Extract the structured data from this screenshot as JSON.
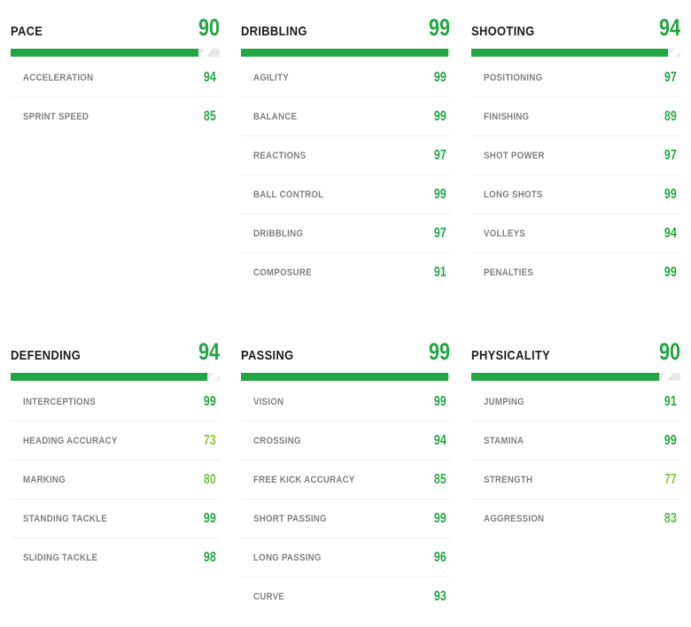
{
  "theme": {
    "background": "#ffffff",
    "title_color": "#1b1b1b",
    "label_color": "#808080",
    "divider_color": "#f0f0f0",
    "bar_track_color": "#e9e9e9",
    "bar_fill_color": "#22a544",
    "value_color_high": "#22a544",
    "value_color_mid": "#4cb050",
    "value_color_low": "#8cc63f"
  },
  "groups": [
    {
      "name": "PACE",
      "value": "90",
      "value_color": "#22a544",
      "bar_percent": 90,
      "stats": [
        {
          "label": "ACCELERATION",
          "value": "94",
          "color": "#22a544"
        },
        {
          "label": "SPRINT SPEED",
          "value": "85",
          "color": "#2faa48"
        }
      ]
    },
    {
      "name": "DRIBBLING",
      "value": "99",
      "value_color": "#22a544",
      "bar_percent": 99,
      "stats": [
        {
          "label": "AGILITY",
          "value": "99",
          "color": "#22a544"
        },
        {
          "label": "BALANCE",
          "value": "99",
          "color": "#22a544"
        },
        {
          "label": "REACTIONS",
          "value": "97",
          "color": "#22a544"
        },
        {
          "label": "BALL CONTROL",
          "value": "99",
          "color": "#22a544"
        },
        {
          "label": "DRIBBLING",
          "value": "97",
          "color": "#22a544"
        },
        {
          "label": "COMPOSURE",
          "value": "91",
          "color": "#2aa847"
        }
      ]
    },
    {
      "name": "SHOOTING",
      "value": "94",
      "value_color": "#22a544",
      "bar_percent": 94,
      "stats": [
        {
          "label": "POSITIONING",
          "value": "97",
          "color": "#22a544"
        },
        {
          "label": "FINISHING",
          "value": "89",
          "color": "#35ac4b"
        },
        {
          "label": "SHOT POWER",
          "value": "97",
          "color": "#22a544"
        },
        {
          "label": "LONG SHOTS",
          "value": "99",
          "color": "#22a544"
        },
        {
          "label": "VOLLEYS",
          "value": "94",
          "color": "#22a544"
        },
        {
          "label": "PENALTIES",
          "value": "99",
          "color": "#22a544"
        }
      ]
    },
    {
      "name": "DEFENDING",
      "value": "94",
      "value_color": "#22a544",
      "bar_percent": 94,
      "stats": [
        {
          "label": "INTERCEPTIONS",
          "value": "99",
          "color": "#22a544"
        },
        {
          "label": "HEADING ACCURACY",
          "value": "73",
          "color": "#8cc63f"
        },
        {
          "label": "MARKING",
          "value": "80",
          "color": "#7cbf43"
        },
        {
          "label": "STANDING TACKLE",
          "value": "99",
          "color": "#22a544"
        },
        {
          "label": "SLIDING TACKLE",
          "value": "98",
          "color": "#22a544"
        }
      ]
    },
    {
      "name": "PASSING",
      "value": "99",
      "value_color": "#22a544",
      "bar_percent": 99,
      "stats": [
        {
          "label": "VISION",
          "value": "99",
          "color": "#22a544"
        },
        {
          "label": "CROSSING",
          "value": "94",
          "color": "#22a544"
        },
        {
          "label": "FREE KICK ACCURACY",
          "value": "85",
          "color": "#2faa48"
        },
        {
          "label": "SHORT PASSING",
          "value": "99",
          "color": "#22a544"
        },
        {
          "label": "LONG PASSING",
          "value": "96",
          "color": "#22a544"
        },
        {
          "label": "CURVE",
          "value": "93",
          "color": "#22a544"
        }
      ]
    },
    {
      "name": "PHYSICALITY",
      "value": "90",
      "value_color": "#22a544",
      "bar_percent": 90,
      "stats": [
        {
          "label": "JUMPING",
          "value": "91",
          "color": "#2aa847"
        },
        {
          "label": "STAMINA",
          "value": "99",
          "color": "#22a544"
        },
        {
          "label": "STRENGTH",
          "value": "77",
          "color": "#8cc63f"
        },
        {
          "label": "AGGRESSION",
          "value": "83",
          "color": "#5fb846"
        }
      ]
    }
  ]
}
